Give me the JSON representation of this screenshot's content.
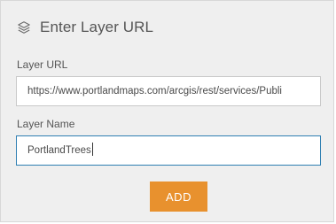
{
  "dialog": {
    "title": "Enter Layer URL",
    "icon": "layers-icon"
  },
  "form": {
    "url_label": "Layer URL",
    "url_value": "https://www.portlandmaps.com/arcgis/rest/services/Publi",
    "name_label": "Layer Name",
    "name_value": "PortlandTrees"
  },
  "actions": {
    "add_label": "ADD"
  },
  "colors": {
    "accent": "#e8912e",
    "focus_border": "#2f7fb2",
    "panel_background": "#efefef"
  }
}
